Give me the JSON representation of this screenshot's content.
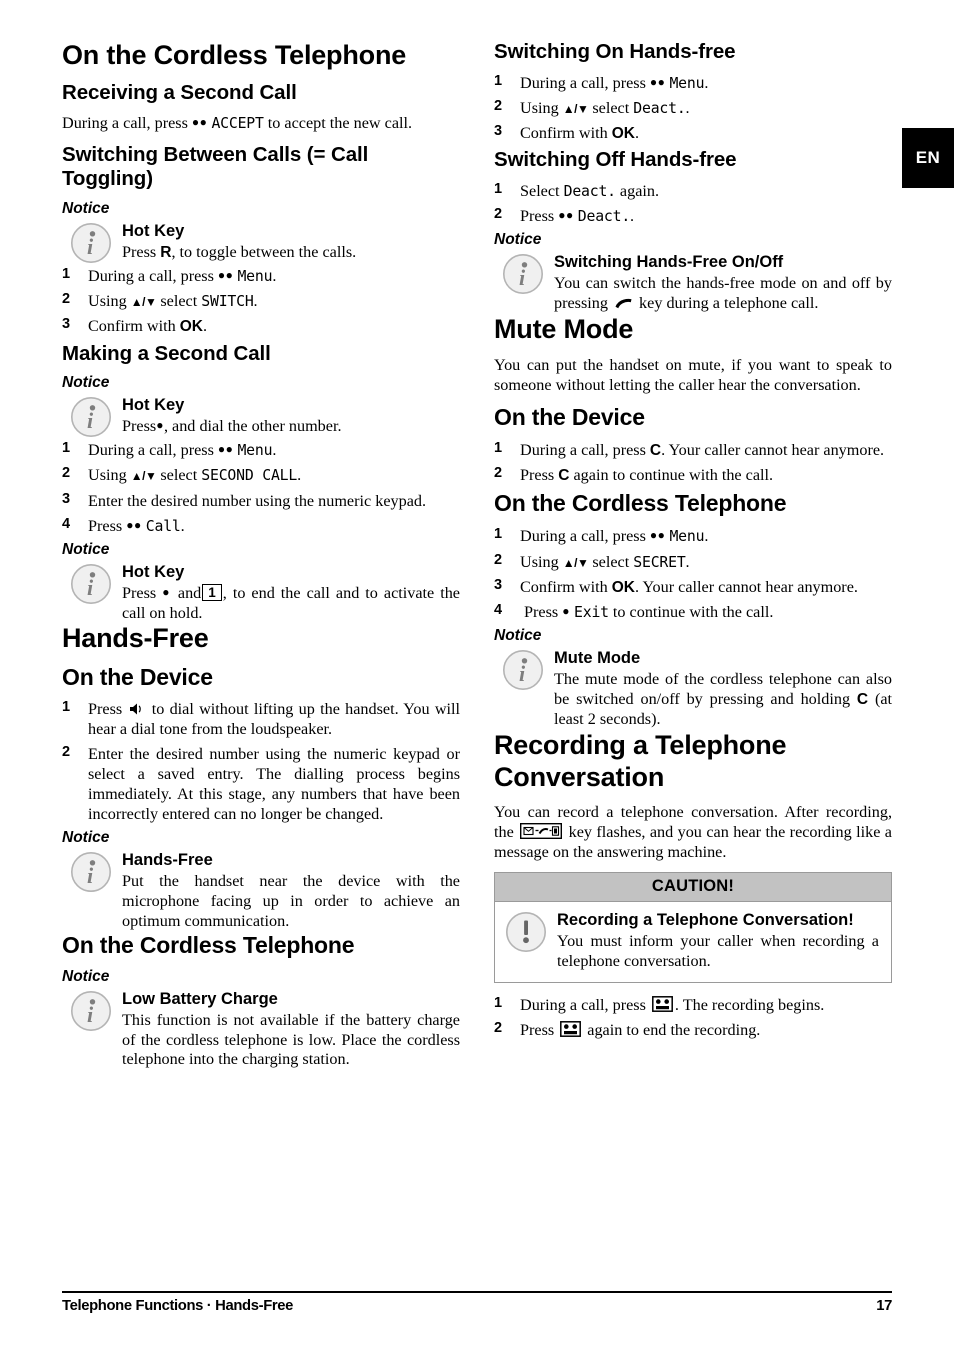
{
  "language_tab": "EN",
  "footer": {
    "left": "Telephone Functions  ·  Hands-Free",
    "page_number": "17"
  },
  "left_column": {
    "heading_cordless": "On the Cordless Telephone",
    "receiving_second_call": {
      "heading": "Receiving a Second Call",
      "text_before": "During a call, press",
      "dots": "●●",
      "lcd": "ACCEPT",
      "text_after": "to accept the new call."
    },
    "switching_between_calls": {
      "heading": "Switching Between Calls (= Call Toggling)",
      "notice_label": "Notice",
      "notice_title": "Hot Key",
      "notice_text_a": "Press",
      "notice_key": "R",
      "notice_text_b": ", to toggle between the calls.",
      "steps": [
        {
          "num": "1",
          "pre": "During a call, press",
          "dots": "●●",
          "lcd": "Menu",
          "post": "."
        },
        {
          "num": "2",
          "pre": "Using",
          "arrows": "▲/▼",
          "mid": "select",
          "lcd": "SWITCH",
          "post": "."
        },
        {
          "num": "3",
          "pre": "Confirm with",
          "key": "OK",
          "post": "."
        }
      ]
    },
    "making_second_call": {
      "heading": "Making a Second Call",
      "notice_label": "Notice",
      "notice_title": "Hot Key",
      "notice_text_a": "Press",
      "notice_dot": "●",
      "notice_text_b": ", and dial the other number.",
      "steps": [
        {
          "num": "1",
          "pre": "During a call, press",
          "dots": "●●",
          "lcd": "Menu",
          "post": "."
        },
        {
          "num": "2",
          "pre": "Using",
          "arrows": "▲/▼",
          "mid": "select",
          "lcd": "SECOND CALL",
          "post": "."
        },
        {
          "num": "3",
          "pre": "Enter the desired number using the numeric keypad."
        },
        {
          "num": "4",
          "pre": "Press",
          "dots": "●●",
          "lcd": "Call",
          "post": "."
        }
      ],
      "notice2_label": "Notice",
      "notice2_title": "Hot Key",
      "notice2_text_a": "Press",
      "notice2_dot": "●",
      "notice2_text_b": "and",
      "notice2_keybox": "1",
      "notice2_text_c": ", to end the call and to activate the call on hold."
    },
    "hands_free": {
      "heading": "Hands-Free",
      "device_heading": "On the Device",
      "steps": [
        {
          "num": "1",
          "pre": "Press",
          "icon": "loudspeaker-icon",
          "post": "to dial without lifting up the handset. You will hear a dial tone from the loudspeaker."
        },
        {
          "num": "2",
          "pre": "Enter the desired number using the numeric keypad or select a saved entry. The dialling process begins immediately. At this stage, any numbers that have been incorrectly entered can no longer be changed."
        }
      ],
      "notice_label": "Notice",
      "notice_title": "Hands-Free",
      "notice_text": "Put the handset near the device with the microphone facing up in order to achieve an optimum communication.",
      "cordless_heading": "On the Cordless Telephone",
      "notice2_label": "Notice",
      "notice2_title": "Low Battery Charge",
      "notice2_text": "This function is not available if the battery charge of the cordless telephone is low. Place the cordless telephone into the charging station."
    }
  },
  "right_column": {
    "switching_on_hands_free": {
      "heading": "Switching On Hands-free",
      "steps": [
        {
          "num": "1",
          "pre": "During a call, press",
          "dots": "●●",
          "lcd": "Menu",
          "post": "."
        },
        {
          "num": "2",
          "pre": "Using",
          "arrows": "▲/▼",
          "mid": "select",
          "lcd": "Deact.",
          "post": "."
        },
        {
          "num": "3",
          "pre": "Confirm with",
          "key": "OK",
          "post": "."
        }
      ]
    },
    "switching_off_hands_free": {
      "heading": "Switching Off Hands-free",
      "steps": [
        {
          "num": "1",
          "pre": "Select",
          "lcd": "Deact.",
          "post": "again."
        },
        {
          "num": "2",
          "pre": "Press",
          "dots": "●●",
          "lcd": "Deact.",
          "post": "."
        }
      ],
      "notice_label": "Notice",
      "notice_title": "Switching Hands-Free On/Off",
      "notice_text_a": "You can switch the hands-free mode on and off by pressing",
      "notice_icon": "handset-icon",
      "notice_text_b": "key during a telephone call."
    },
    "mute_mode": {
      "heading": "Mute Mode",
      "intro": "You can put the handset on mute, if you want to speak to someone without letting the caller hear the conversation.",
      "device_heading": "On the Device",
      "device_steps": [
        {
          "num": "1",
          "pre": "During a call, press",
          "key": "C",
          "post": ". Your caller cannot hear anymore."
        },
        {
          "num": "2",
          "pre": "Press",
          "key": "C",
          "post": "again to continue with the call."
        }
      ],
      "cordless_heading": "On the Cordless Telephone",
      "cordless_steps": [
        {
          "num": "1",
          "pre": "During a call, press",
          "dots": "●●",
          "lcd": "Menu",
          "post": "."
        },
        {
          "num": "2",
          "pre": "Using",
          "arrows": "▲/▼",
          "mid": "select",
          "lcd": "SECRET",
          "post": "."
        },
        {
          "num": "3",
          "pre": "Confirm with",
          "key": "OK",
          "post": ". Your caller cannot hear anymore."
        },
        {
          "num": "4",
          "pre": "Press",
          "dot": "●",
          "lcd": "Exit",
          "post": "to continue with the call."
        }
      ],
      "notice_label": "Notice",
      "notice_title": "Mute Mode",
      "notice_text_a": "The mute mode of the cordless telephone can also be switched on/off by pressing and holding",
      "notice_key": "C",
      "notice_text_b": "(at least 2 seconds)."
    },
    "recording": {
      "heading": "Recording a Telephone Conversation",
      "intro_a": "You can record a telephone conversation. After recording, the",
      "intro_icon": "answering-machine-key-icon",
      "intro_b": "key flashes, and you can hear the recording like a message on the answering machine.",
      "caution_header": "CAUTION!",
      "caution_title": "Recording a Telephone Conversation!",
      "caution_text": "You must inform your caller when recording a telephone conversation.",
      "steps": [
        {
          "num": "1",
          "pre": "During a call, press",
          "icon": "cassette-icon",
          "post": ". The recording begins."
        },
        {
          "num": "2",
          "pre": "Press",
          "icon": "cassette-icon",
          "post": "again to end the recording."
        }
      ]
    }
  },
  "colors": {
    "caution_header_bg": "#c2c2c2",
    "caution_border": "#9a9a9a",
    "icon_gray": "#8e8e8e",
    "tab_bg": "#000000"
  }
}
